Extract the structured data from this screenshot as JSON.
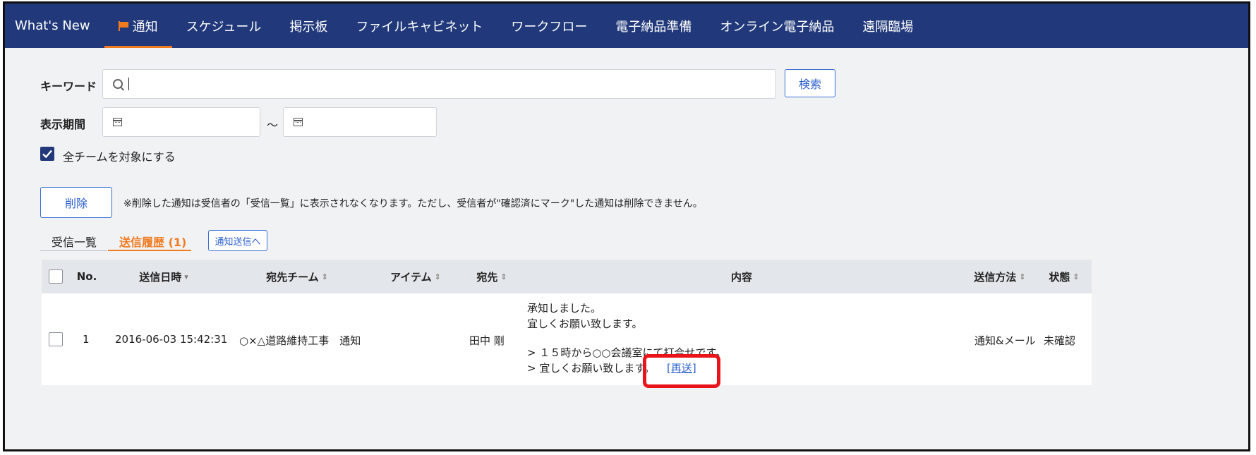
{
  "nav": {
    "items": [
      "What's New",
      "通知",
      "スケジュール",
      "掲示板",
      "ファイルキャビネット",
      "ワークフロー",
      "電子納品準備",
      "オンライン電子納品",
      "遠隔臨場"
    ],
    "active_index": 1
  },
  "filters": {
    "keyword_label": "キーワード",
    "keyword_value": "",
    "search_button": "検索",
    "period_label": "表示期間",
    "period_separator": "～",
    "all_teams_label": "全チームを対象にする",
    "all_teams_checked": true
  },
  "actions": {
    "delete_button": "削除",
    "delete_note": "※削除した通知は受信者の「受信一覧」に表示されなくなります。ただし、受信者が\"確認済にマーク\"した通知は削除できません。"
  },
  "tabs": {
    "received": "受信一覧",
    "sent": "送信履歴 (1)",
    "send_button": "通知送信へ"
  },
  "table": {
    "headers": {
      "no": "No.",
      "date": "送信日時",
      "team": "宛先チーム",
      "item": "アイテム",
      "to": "宛先",
      "content": "内容",
      "method": "送信方法",
      "status": "状態"
    },
    "sort_down": "▾",
    "sort_both": "⇕",
    "rows": [
      {
        "no": "1",
        "date": "2016-06-03 15:42:31",
        "team": "○×△道路維持工事　通知",
        "item": "",
        "to": "田中 剛",
        "content_line1": "承知しました。",
        "content_line2": "宜しくお願い致します。",
        "content_quote1": "> １５時から○○会議室にて打合せです。",
        "content_quote2": "> 宜しくお願い致します。",
        "resend_link": "[再送]",
        "method": "通知&メール",
        "status": "未確認"
      }
    ]
  },
  "colors": {
    "nav_bg": "#21397a",
    "accent_orange": "#f07b1f",
    "link_blue": "#2a5fcf",
    "highlight_red": "#e8141a"
  }
}
